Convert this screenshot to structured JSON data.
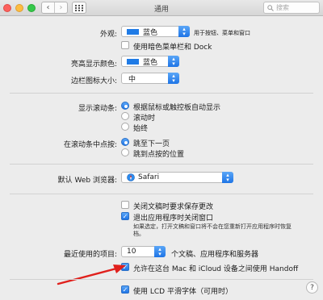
{
  "window": {
    "title": "通用"
  },
  "toolbar": {
    "back_glyph": "‹",
    "forward_glyph": "›",
    "search_placeholder": "搜索"
  },
  "appearance": {
    "label": "外观:",
    "value": "蓝色",
    "hint": "用于按钮、菜单和窗口",
    "dark_menu_label": "使用暗色菜单栏和 Dock"
  },
  "highlight": {
    "label": "亮高显示颜色:",
    "value": "蓝色"
  },
  "sidebar_icon": {
    "label": "边栏图标大小:",
    "value": "中"
  },
  "scrollbars": {
    "label": "显示滚动条:",
    "options": [
      "根据鼠标或触控板自动显示",
      "滚动时",
      "始终"
    ],
    "selected_index": 0
  },
  "click_scrollbar": {
    "label": "在滚动条中点按:",
    "options": [
      "跳至下一页",
      "跳到点按的位置"
    ],
    "selected_index": 0
  },
  "browser": {
    "label": "默认 Web 浏览器:",
    "value": "Safari",
    "icon": "safari-icon"
  },
  "documents": {
    "ask_save_label": "关闭文稿时要求保存更改",
    "ask_save_checked": false,
    "close_windows_label": "退出应用程序时关闭窗口",
    "close_windows_checked": true,
    "note": "如果选定，打开文稿和窗口将不会在您重新打开应用程序时恢复",
    "note_line2": "档。"
  },
  "recent": {
    "label": "最近使用的项目:",
    "value": "10",
    "suffix": "个文稿、应用程序和服务器"
  },
  "handoff": {
    "label": "允许在这台 Mac 和 iCloud 设备之间使用 Handoff",
    "checked": true
  },
  "lcd": {
    "label": "使用 LCD 平滑字体（可用时）",
    "checked": true
  },
  "colors": {
    "accent": "#1e74e6",
    "arrow": "#e0201c"
  }
}
